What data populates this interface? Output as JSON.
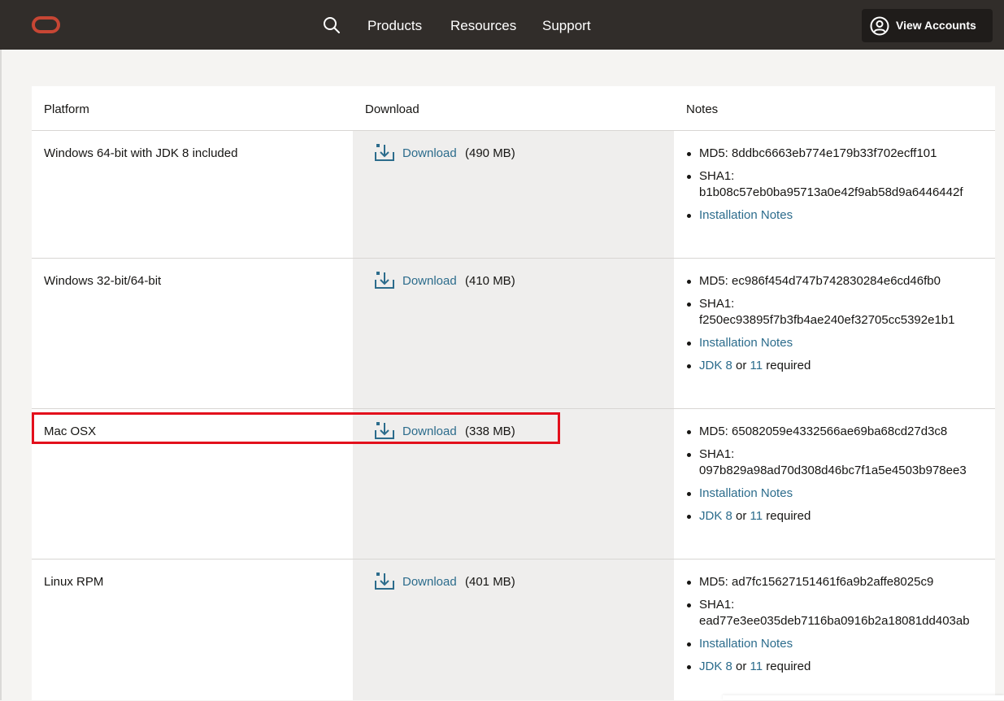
{
  "header": {
    "nav": [
      "Products",
      "Resources",
      "Support"
    ],
    "account_label": "View Accounts"
  },
  "table": {
    "headers": {
      "platform": "Platform",
      "download": "Download",
      "notes": "Notes"
    },
    "rows": [
      {
        "platform": "Windows 64-bit with JDK 8 included",
        "download_label": "Download",
        "size": "(490 MB)",
        "md5": "MD5: 8ddbc6663eb774e179b33f702ecff101",
        "sha1_label": "SHA1:",
        "sha1": "b1b08c57eb0ba95713a0e42f9ab58d9a6446442f",
        "install_notes": "Installation Notes"
      },
      {
        "platform": "Windows 32-bit/64-bit",
        "download_label": "Download",
        "size": "(410 MB)",
        "md5": "MD5: ec986f454d747b742830284e6cd46fb0",
        "sha1_label": "SHA1:",
        "sha1": "f250ec93895f7b3fb4ae240ef32705cc5392e1b1",
        "install_notes": "Installation Notes",
        "jdk_8": "JDK 8",
        "or": "or",
        "jdk_11": "11",
        "required": "required"
      },
      {
        "platform": "Mac OSX",
        "download_label": "Download",
        "size": "(338 MB)",
        "md5": "MD5: 65082059e4332566ae69ba68cd27d3c8",
        "sha1_label": "SHA1:",
        "sha1": "097b829a98ad70d308d46bc7f1a5e4503b978ee3",
        "install_notes": "Installation Notes",
        "jdk_8": "JDK 8",
        "or": "or",
        "jdk_11": "11",
        "required": "required"
      },
      {
        "platform": "Linux RPM",
        "download_label": "Download",
        "size": "(401 MB)",
        "md5": "MD5: ad7fc15627151461f6a9b2affe8025c9",
        "sha1_label": "SHA1:",
        "sha1": "ead77e3ee035deb7116ba0916b2a18081dd403ab",
        "install_notes": "Installation Notes",
        "jdk_8": "JDK 8",
        "or": "or",
        "jdk_11": "11",
        "required": "required"
      }
    ]
  },
  "colors": {
    "header_bg": "#312d2a",
    "brand": "#c74634",
    "link": "#2c6c8c",
    "highlight": "#e3101c"
  }
}
